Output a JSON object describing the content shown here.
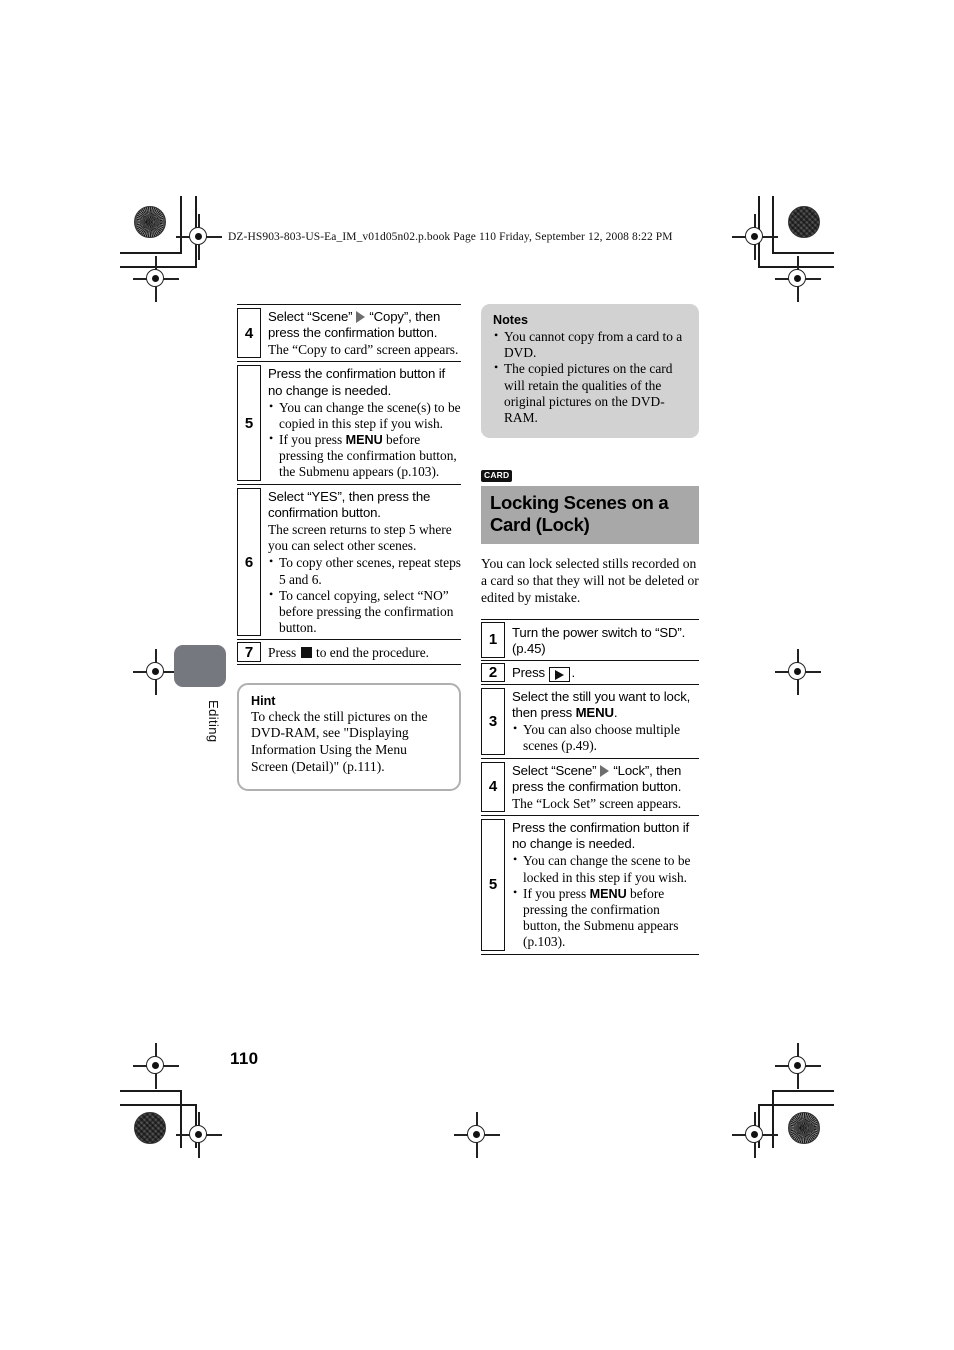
{
  "header": {
    "file_line": "DZ-HS903-803-US-Ea_IM_v01d05n02.p.book  Page 110  Friday, September 12, 2008  8:22 PM"
  },
  "side_tab": {
    "label": "Editing"
  },
  "page": {
    "number": "110"
  },
  "colors": {
    "heading_band": "#a8a8a8",
    "notes_bg": "#d2d2d2",
    "side_tab": "#76787f",
    "arrow": "#6e6e6e",
    "hint_border": "#b0b0b0"
  },
  "left_column": {
    "steps": [
      {
        "num": "4",
        "lead_a": "Select “Scene”",
        "arrow": "arrow-right-icon",
        "lead_b": "“Copy”, then press the confirmation button.",
        "sub": "The “Copy to card” screen appears.",
        "bullets": []
      },
      {
        "num": "5",
        "lead": "Press the confirmation button if no change is needed.",
        "sub": "",
        "bullets": [
          "You can change the scene(s) to be copied in this step if you wish.",
          "If you press MENU before pressing the confirmation button, the Submenu appears (p.103)."
        ],
        "bullet_bold": "MENU"
      },
      {
        "num": "6",
        "lead": "Select “YES”, then press the confirmation button.",
        "sub": "The screen returns to step 5 where you can select other scenes.",
        "bullets": [
          "To copy other scenes, repeat steps 5 and 6.",
          "To cancel copying, select “NO” before pressing the confirmation button."
        ]
      },
      {
        "num": "7",
        "lead_a": "Press",
        "icon": "stop-square-icon",
        "lead_b": "to end the procedure.",
        "bullets": []
      }
    ],
    "hint": {
      "title": "Hint",
      "text": "To check the still pictures on the DVD-RAM, see \"Displaying Information Using the Menu Screen (Detail)\" (p.111)."
    }
  },
  "right_column": {
    "notes": {
      "title": "Notes",
      "items": [
        "You cannot copy from a card to a DVD.",
        "The copied pictures on the card will retain the qualities of the original pictures on the DVD-RAM."
      ]
    },
    "section": {
      "badge": "CARD",
      "title": "Locking Scenes on a Card (Lock)",
      "intro": "You can lock selected stills recorded on a card so that they will not be deleted or edited by mistake."
    },
    "steps": [
      {
        "num": "1",
        "lead": "Turn the power switch to “SD”. (p.45)",
        "bullets": []
      },
      {
        "num": "2",
        "lead_a": "Press",
        "icon": "play-button-icon",
        "lead_b": ".",
        "bullets": []
      },
      {
        "num": "3",
        "lead": "Select the still you want to lock, then press MENU.",
        "lead_bold": "MENU",
        "bullets": [
          "You can also choose multiple scenes (p.49)."
        ]
      },
      {
        "num": "4",
        "lead_a": "Select “Scene”",
        "arrow": "arrow-right-icon",
        "lead_b": "“Lock”, then press the confirmation button.",
        "sub": "The “Lock Set” screen appears.",
        "bullets": []
      },
      {
        "num": "5",
        "lead": "Press the confirmation button if no change is needed.",
        "bullets": [
          "You can change the scene to be locked in this step if you wish.",
          "If you press MENU before pressing the confirmation button, the Submenu appears (p.103)."
        ],
        "bullet_bold": "MENU"
      }
    ]
  }
}
